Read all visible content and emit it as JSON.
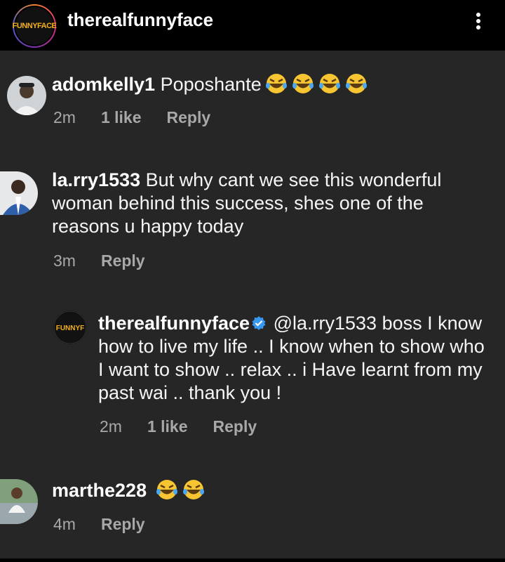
{
  "header": {
    "username": "therealfunnyface",
    "avatar_text": "FUNNYFACE",
    "menu_icon": "more-vertical-icon"
  },
  "comments": [
    {
      "username": "adomkelly1",
      "text": "Poposhante",
      "emoji": "face-with-tears-of-joy x4",
      "time": "2m",
      "likes": "1 like",
      "reply": "Reply"
    },
    {
      "username": "la.rry1533",
      "text": "But why cant we see this wonderful woman behind this success, shes one of the reasons u happy today",
      "time": "3m",
      "reply": "Reply"
    },
    {
      "username": "therealfunnyface",
      "verified": true,
      "text": "@la.rry1533 boss I know how to live my life .. I know when to show who I want to show .. relax .. i Have learnt from my past wai .. thank you !",
      "time": "2m",
      "likes": "1 like",
      "reply": "Reply"
    },
    {
      "username": "marthe228",
      "emoji": "face-with-tears-of-joy x2",
      "time": "4m",
      "reply": "Reply"
    }
  ],
  "colors": {
    "background": "#262626",
    "header": "#000000",
    "meta_text": "#a8a8a8",
    "verified_badge": "#3897f0",
    "emoji": "#f7c531"
  }
}
